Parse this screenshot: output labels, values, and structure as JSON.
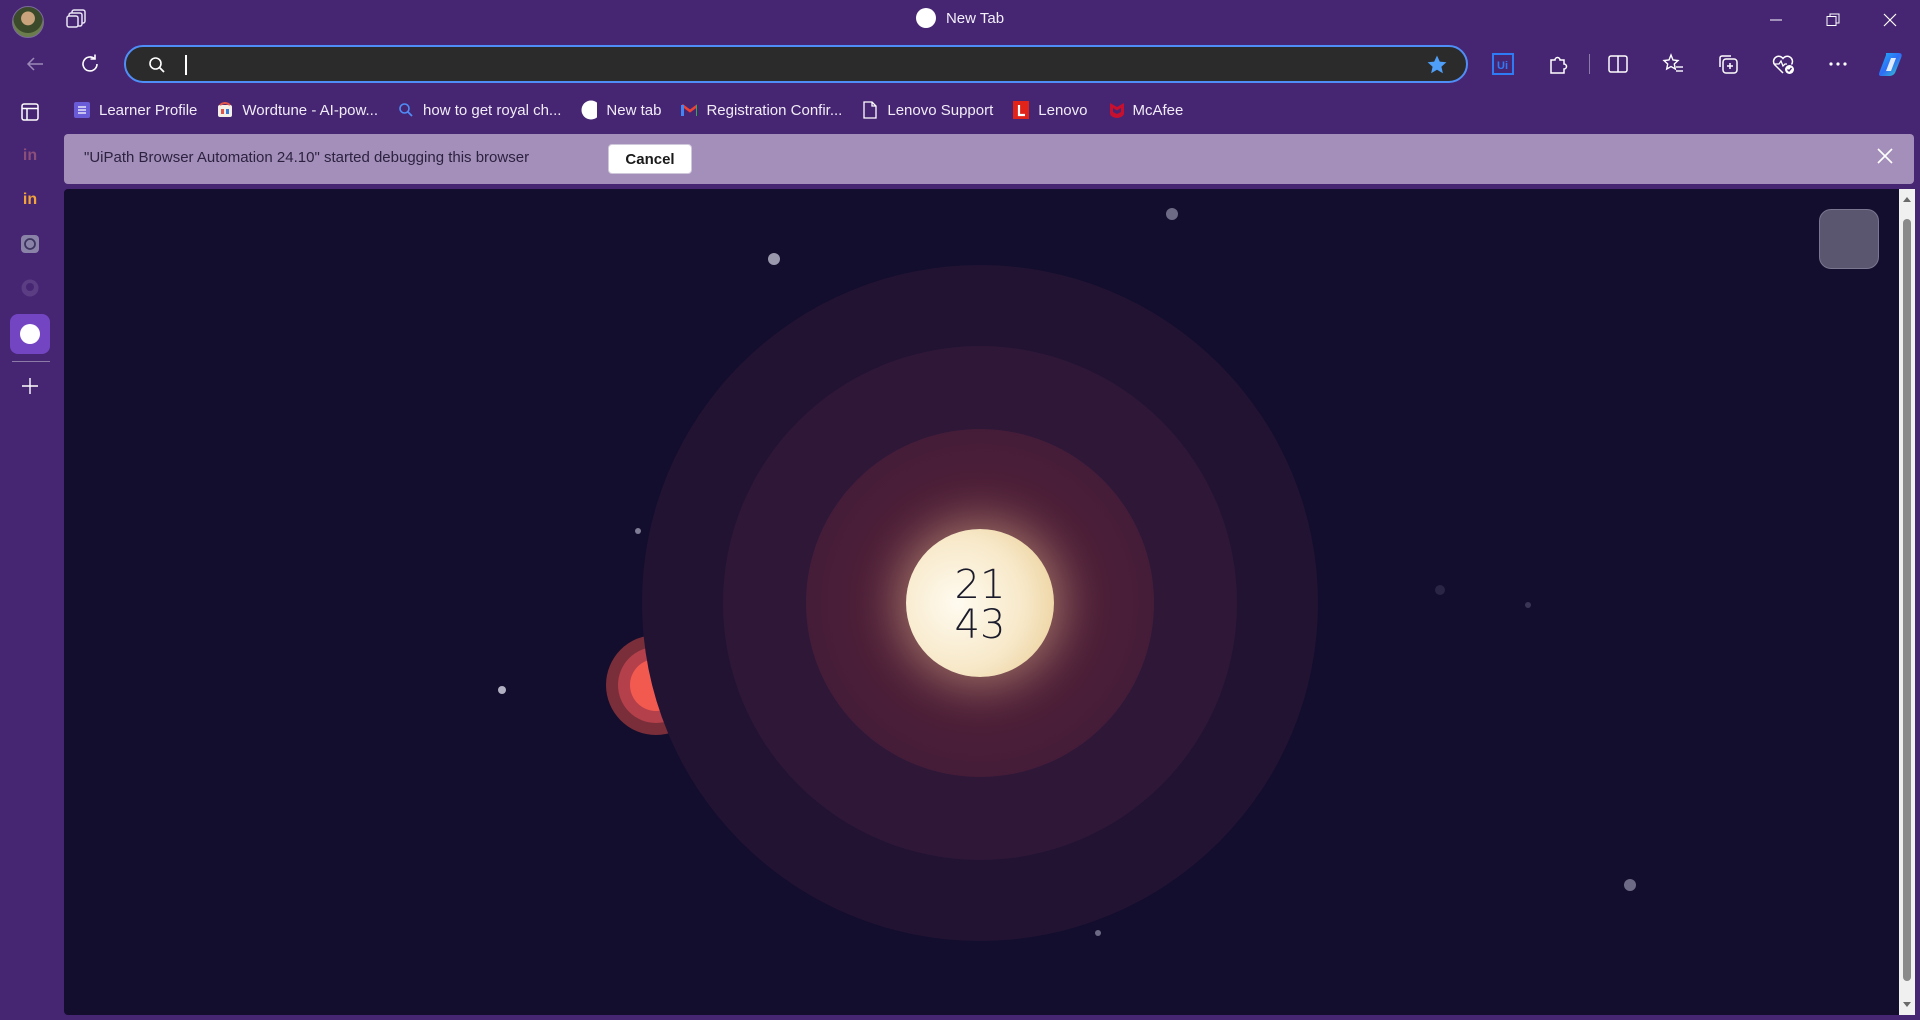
{
  "window": {
    "title": "New Tab"
  },
  "omnibox": {
    "value": "",
    "placeholder": ""
  },
  "favorites": [
    {
      "label": "Learner Profile",
      "icon": "list-icon",
      "color": "#6a5cd6"
    },
    {
      "label": "Wordtune - AI-pow...",
      "icon": "wordtune-icon",
      "color": "#e0564a"
    },
    {
      "label": "how to get royal ch...",
      "icon": "search-icon",
      "color": "#4f8ef7"
    },
    {
      "label": "New tab",
      "icon": "circle-icon",
      "color": "#ffffff"
    },
    {
      "label": "Registration Confir...",
      "icon": "gmail-icon",
      "color": "#ea4335"
    },
    {
      "label": "Lenovo Support",
      "icon": "page-icon",
      "color": "#ffffff"
    },
    {
      "label": "Lenovo",
      "icon": "lenovo-icon",
      "color": "#e2231a"
    },
    {
      "label": "McAfee",
      "icon": "mcafee-icon",
      "color": "#c8102e"
    }
  ],
  "infobar": {
    "message": "\"UiPath Browser Automation 24.10\" started debugging this browser",
    "cancel_label": "Cancel"
  },
  "clock": {
    "hours": "21",
    "minutes": "43"
  },
  "colors": {
    "frame": "#462573",
    "accent": "#4f8ef7",
    "page_background": "#130e2d",
    "infobar": "#a48fba"
  }
}
